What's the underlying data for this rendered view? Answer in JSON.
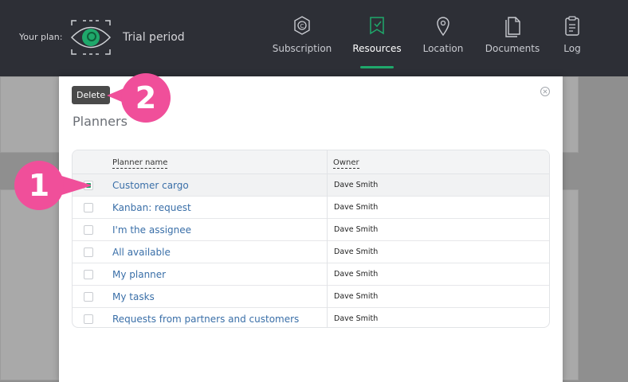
{
  "topbar": {
    "plan_label": "Your plan:",
    "plan_name": "Trial period",
    "nav": [
      {
        "label": "Subscription",
        "icon": "subscription-icon",
        "active": false
      },
      {
        "label": "Resources",
        "icon": "resources-icon",
        "active": true
      },
      {
        "label": "Location",
        "icon": "location-pin-icon",
        "active": false
      },
      {
        "label": "Documents",
        "icon": "documents-icon",
        "active": false
      },
      {
        "label": "Log",
        "icon": "log-icon",
        "active": false
      }
    ],
    "accent": "#1fa86b"
  },
  "modal": {
    "delete_label": "Delete",
    "title": "Planners",
    "columns": [
      "Planner name",
      "Owner"
    ],
    "rows": [
      {
        "name": "Customer cargo",
        "owner": "Dave Smith",
        "checked": true
      },
      {
        "name": "Kanban: request",
        "owner": "Dave Smith",
        "checked": false
      },
      {
        "name": "I'm the assignee",
        "owner": "Dave Smith",
        "checked": false
      },
      {
        "name": "All available",
        "owner": "Dave Smith",
        "checked": false
      },
      {
        "name": "My planner",
        "owner": "Dave Smith",
        "checked": false
      },
      {
        "name": "My tasks",
        "owner": "Dave Smith",
        "checked": false
      },
      {
        "name": "Requests from partners and customers",
        "owner": "Dave Smith",
        "checked": false
      }
    ]
  },
  "callouts": {
    "one": "1",
    "two": "2",
    "color": "#f04f9a"
  }
}
